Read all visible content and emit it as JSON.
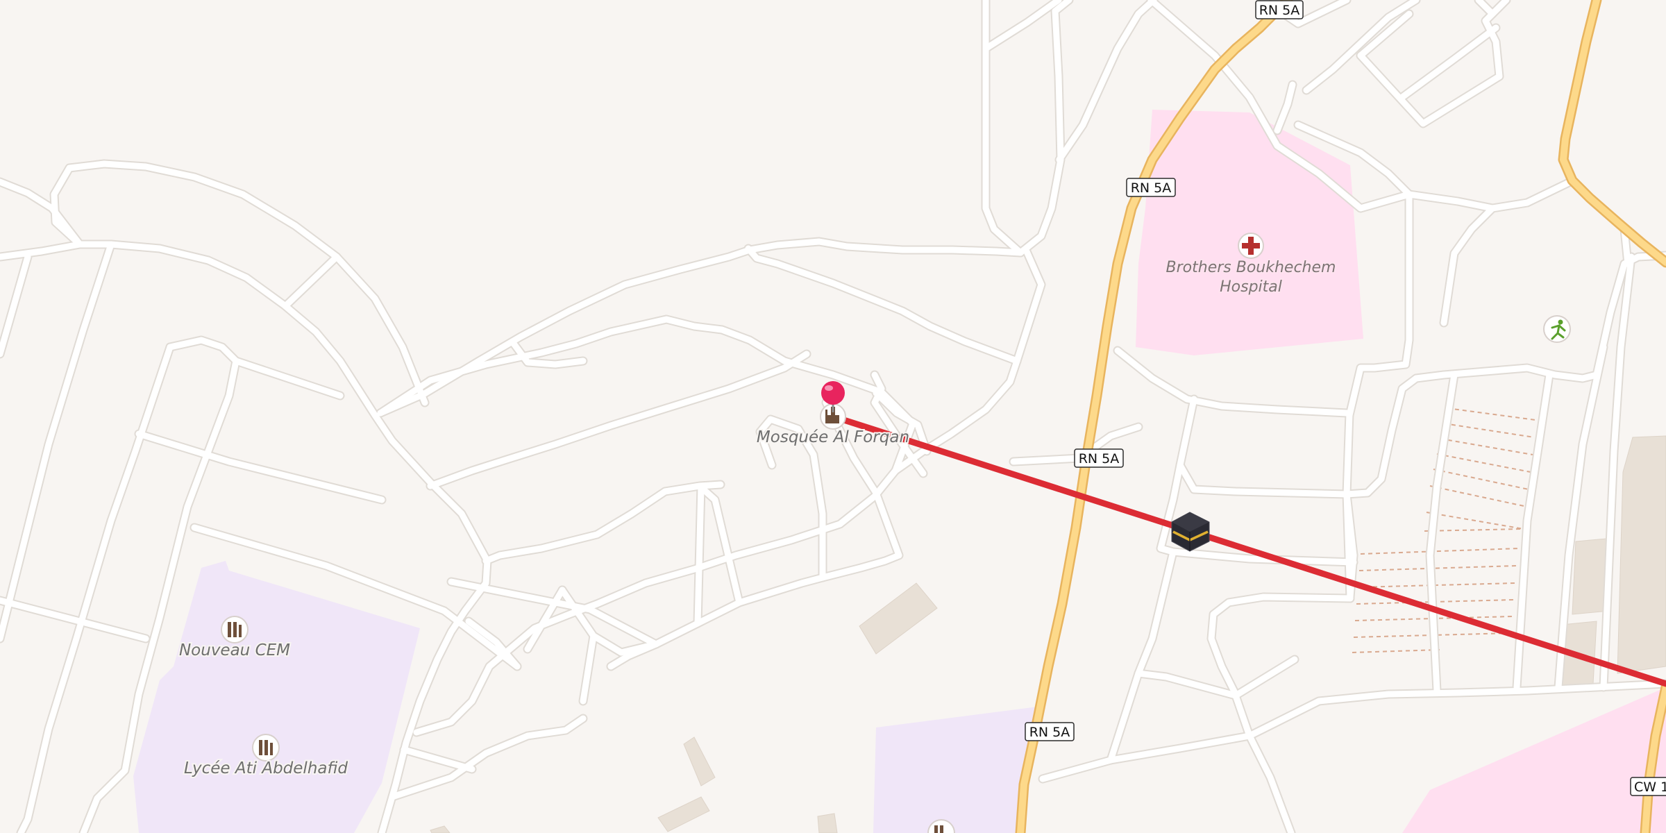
{
  "map": {
    "background": "#f8f5f2",
    "colors": {
      "road": "#ffffff",
      "road_casing": "#e0dbd5",
      "primary_road": "#fdd98a",
      "primary_road_casing": "#e8b45e",
      "hospital_area": "#ffdff0",
      "school_area": "#f0e6f8",
      "route": "#dc2c34",
      "pin": "#e8245e",
      "buildings": "#e8e0d6"
    },
    "road_shields": [
      "RN 5A",
      "RN 5A",
      "RN 5A",
      "RN 5A",
      "CW 1"
    ],
    "labels": {
      "mosque": "Mosquée Al Forqan",
      "hospital_line1": "Brothers Boukhechem",
      "hospital_line2": "Hospital",
      "school1": "Nouveau CEM",
      "school2": "Lycée Ati Abdelhafid"
    },
    "icons": {
      "pin": "map-pin-icon",
      "mosque": "mosque-icon",
      "hospital": "hospital-cross-icon",
      "school1": "school-icon",
      "school2": "school-icon",
      "kaaba": "kaaba-icon",
      "sport": "sport-runner-icon"
    }
  }
}
